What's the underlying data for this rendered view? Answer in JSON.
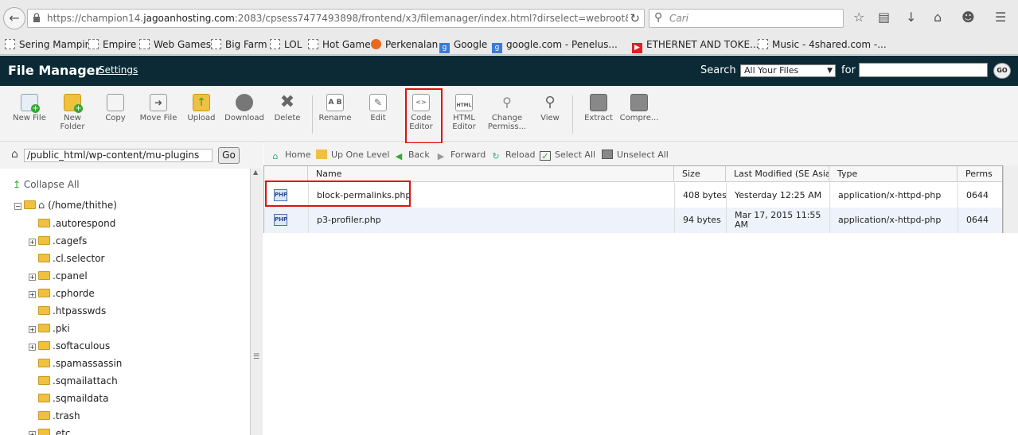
{
  "browser": {
    "url_prefix": "https://champion14.",
    "url_host": "jagoanhosting.com",
    "url_rest": ":2083/cpsess7477493898/frontend/x3/filemanager/index.html?dirselect=webroot&domainselec",
    "search_placeholder": "Cari"
  },
  "bookmarks": [
    {
      "label": "Sering Mampir",
      "icon": "dashed-box"
    },
    {
      "label": "Empire",
      "icon": "dashed-box"
    },
    {
      "label": "Web Games",
      "icon": "dashed-box"
    },
    {
      "label": "Big Farm",
      "icon": "dashed-box"
    },
    {
      "label": "LOL",
      "icon": "dashed-box"
    },
    {
      "label": "Hot Game",
      "icon": "dashed-box"
    },
    {
      "label": "Perkenalan",
      "icon": "firefox"
    },
    {
      "label": "Google",
      "icon": "google"
    },
    {
      "label": "google.com - Penelus...",
      "icon": "google"
    },
    {
      "label": "ETHERNET AND TOKE...",
      "icon": "youtube"
    },
    {
      "label": "Music - 4shared.com -...",
      "icon": "dashed-box"
    }
  ],
  "header": {
    "title": "File Manager",
    "settings": "Settings",
    "search_label": "Search",
    "search_scope": "All Your Files",
    "for_label": "for",
    "go": "GO"
  },
  "toolbar": [
    {
      "l1": "New File",
      "l2": ""
    },
    {
      "l1": "New",
      "l2": "Folder"
    },
    {
      "l1": "Copy",
      "l2": ""
    },
    {
      "l1": "Move File",
      "l2": ""
    },
    {
      "l1": "Upload",
      "l2": ""
    },
    {
      "l1": "Download",
      "l2": ""
    },
    {
      "l1": "Delete",
      "l2": ""
    },
    {
      "l1": "Rename",
      "l2": ""
    },
    {
      "l1": "Edit",
      "l2": ""
    },
    {
      "l1": "Code",
      "l2": "Editor"
    },
    {
      "l1": "HTML",
      "l2": "Editor"
    },
    {
      "l1": "Change",
      "l2": "Permiss..."
    },
    {
      "l1": "View",
      "l2": ""
    },
    {
      "l1": "Extract",
      "l2": ""
    },
    {
      "l1": "Compre...",
      "l2": ""
    }
  ],
  "path": {
    "value": "/public_html/wp-content/mu-plugins",
    "go": "Go"
  },
  "tree": {
    "collapse_all": "Collapse All",
    "root": "(/home/thithe)",
    "items": [
      {
        "name": ".autorespond",
        "expandable": false
      },
      {
        "name": ".cagefs",
        "expandable": true
      },
      {
        "name": ".cl.selector",
        "expandable": false
      },
      {
        "name": ".cpanel",
        "expandable": true
      },
      {
        "name": ".cphorde",
        "expandable": true
      },
      {
        "name": ".htpasswds",
        "expandable": false
      },
      {
        "name": ".pki",
        "expandable": true
      },
      {
        "name": ".softaculous",
        "expandable": true
      },
      {
        "name": ".spamassassin",
        "expandable": false
      },
      {
        "name": ".sqmailattach",
        "expandable": false
      },
      {
        "name": ".sqmaildata",
        "expandable": false
      },
      {
        "name": ".trash",
        "expandable": false
      },
      {
        "name": ".etc",
        "expandable": true
      }
    ]
  },
  "nav": {
    "home": "Home",
    "up": "Up One Level",
    "back": "Back",
    "forward": "Forward",
    "reload": "Reload",
    "select_all": "Select All",
    "unselect_all": "Unselect All"
  },
  "table": {
    "headers": [
      "Name",
      "Size",
      "Last Modified (SE Asia S",
      "Type",
      "Perms"
    ],
    "rows": [
      {
        "icon": "PHP",
        "name": "block-permalinks.php",
        "size": "408 bytes",
        "modified": "Yesterday 12:25 AM",
        "type": "application/x-httpd-php",
        "perms": "0644"
      },
      {
        "icon": "PHP",
        "name": "p3-profiler.php",
        "size": "94 bytes",
        "modified": "Mar 17, 2015 11:55 AM",
        "type": "application/x-httpd-php",
        "perms": "0644"
      }
    ]
  },
  "colors": {
    "header_bg": "#0b2a36",
    "highlight": "#e01010"
  }
}
